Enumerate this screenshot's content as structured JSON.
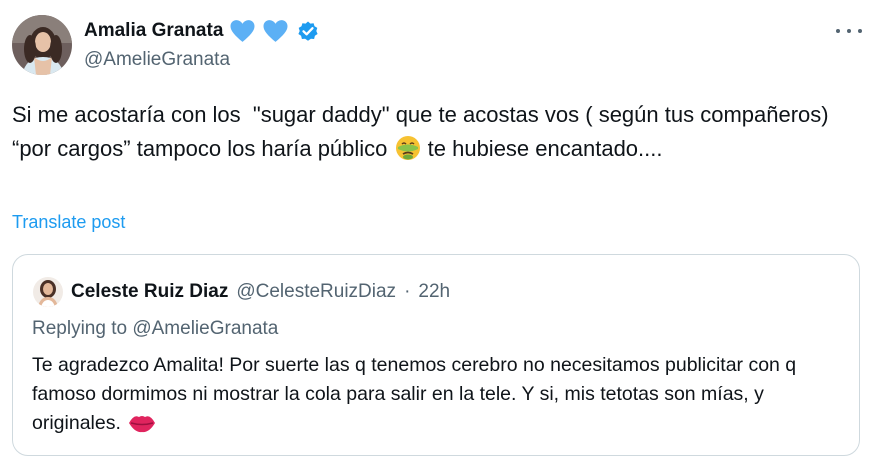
{
  "author": {
    "display_name": "Amalia Granata",
    "handle": "@AmelieGranata",
    "avatar": "profile-photo",
    "name_emojis": [
      "blue-heart-icon",
      "blue-heart-icon"
    ],
    "verified": true
  },
  "tweet": {
    "text_part1": "Si me acostaría con los  \"sugar daddy\" que te acostas vos ( según tus compañeros) “por cargos” tampoco los haría público ",
    "emoji": "nauseated-face-icon",
    "text_part2": " te hubiese encantado....",
    "translate_label": "Translate post"
  },
  "quoted_tweet": {
    "display_name": "Celeste Ruiz Diaz",
    "handle": "@CelesteRuizDiaz",
    "separator": "·",
    "time": "22h",
    "replying_prefix": "Replying to ",
    "replying_to": "@AmelieGranata",
    "text": "Te agradezco Amalita! Por suerte las q tenemos cerebro no necesitamos publicitar con q famoso dormimos ni mostrar la cola para salir en la tele. Y si, mis tetotas son mías, y originales.",
    "emoji": "kiss-mark-icon"
  },
  "colors": {
    "text": "#0f1419",
    "secondary": "#536471",
    "link": "#1d9bf0",
    "verified": "#1d9bf0",
    "heart": "#5cb0f5",
    "border": "#cfd9de"
  }
}
